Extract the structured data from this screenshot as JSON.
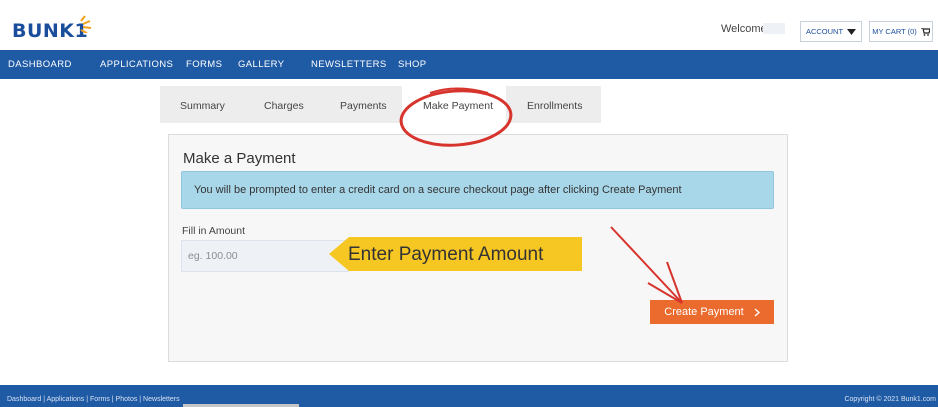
{
  "brand": {
    "logo_text": "BUNK1"
  },
  "header": {
    "welcome": "Welcome",
    "account_label": "ACCOUNT",
    "cart_label": "MY CART (0)"
  },
  "nav": {
    "items": [
      "DASHBOARD",
      "APPLICATIONS",
      "FORMS",
      "GALLERY",
      "NEWSLETTERS",
      "SHOP"
    ]
  },
  "tabs": {
    "items": [
      "Summary",
      "Charges",
      "Payments",
      "Make Payment",
      "Enrollments"
    ],
    "active": "Make Payment"
  },
  "panel": {
    "title": "Make a Payment",
    "alert": "You will be prompted to enter a credit card on a secure checkout page after clicking Create Payment",
    "amount_label": "Fill in Amount",
    "amount_placeholder": "eg. 100.00",
    "callout": "Enter Payment Amount",
    "create_button": "Create Payment"
  },
  "footer": {
    "links": "Dashboard | Applications | Forms | Photos | Newsletters",
    "copyright": "Copyright © 2021 Bunk1.com"
  },
  "colors": {
    "nav": "#1f5aa5",
    "accent": "#ea6b2d",
    "alert": "#a9d7ea",
    "callout": "#f6c623",
    "annotation": "#d6342c"
  }
}
